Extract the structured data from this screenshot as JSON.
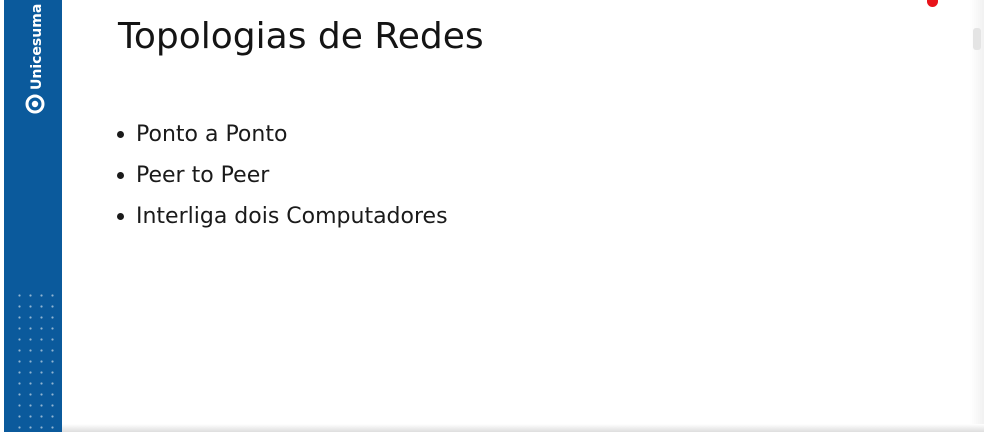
{
  "slide": {
    "title": "Topologias de Redes",
    "bullets": [
      "Ponto a Ponto",
      "Peer to Peer",
      "Interliga dois Computadores"
    ]
  },
  "brand": {
    "name": "Unicesumar",
    "icon": "unicesumar-logo-icon",
    "color": "#0b5a9c"
  },
  "pointer": {
    "icon": "laser-pointer-icon",
    "color": "#e8131a"
  }
}
